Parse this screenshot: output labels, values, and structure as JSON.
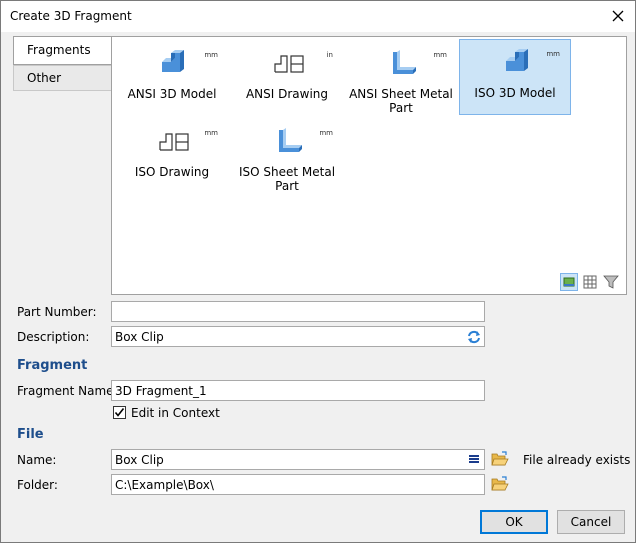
{
  "window": {
    "title": "Create 3D Fragment"
  },
  "tabs": [
    {
      "label": "Fragments"
    },
    {
      "label": "Other"
    }
  ],
  "templates": [
    {
      "label": "ANSI 3D Model",
      "unit": "mm",
      "icon": "3d-model-icon"
    },
    {
      "label": "ANSI Drawing",
      "unit": "in",
      "icon": "drawing-icon"
    },
    {
      "label": "ANSI Sheet Metal Part",
      "unit": "mm",
      "icon": "sheet-metal-icon"
    },
    {
      "label": "ISO 3D Model",
      "unit": "mm",
      "icon": "3d-model-icon",
      "selected": true
    },
    {
      "label": "ISO Drawing",
      "unit": "mm",
      "icon": "drawing-icon"
    },
    {
      "label": "ISO Sheet Metal Part",
      "unit": "mm",
      "icon": "sheet-metal-icon"
    }
  ],
  "view_buttons": [
    "large-icons-view-icon",
    "grid-view-icon",
    "filter-icon"
  ],
  "form": {
    "part_number_label": "Part Number:",
    "part_number_value": "",
    "description_label": "Description:",
    "description_value": "Box Clip",
    "fragment_section": "Fragment",
    "fragment_name_label": "Fragment Name:",
    "fragment_name_value": "3D Fragment_1",
    "edit_in_context_label": "Edit in Context",
    "edit_in_context_checked": true,
    "file_section": "File",
    "name_label": "Name:",
    "name_value": "Box Clip",
    "file_status": "File already exists",
    "folder_label": "Folder:",
    "folder_value": "C:\\Example\\Box\\"
  },
  "buttons": {
    "ok": "OK",
    "cancel": "Cancel"
  },
  "colors": {
    "accent": "#0078d7",
    "section": "#1e4e8c",
    "selected_bg": "#cce4f7",
    "icon_blue": "#4a90d9"
  }
}
